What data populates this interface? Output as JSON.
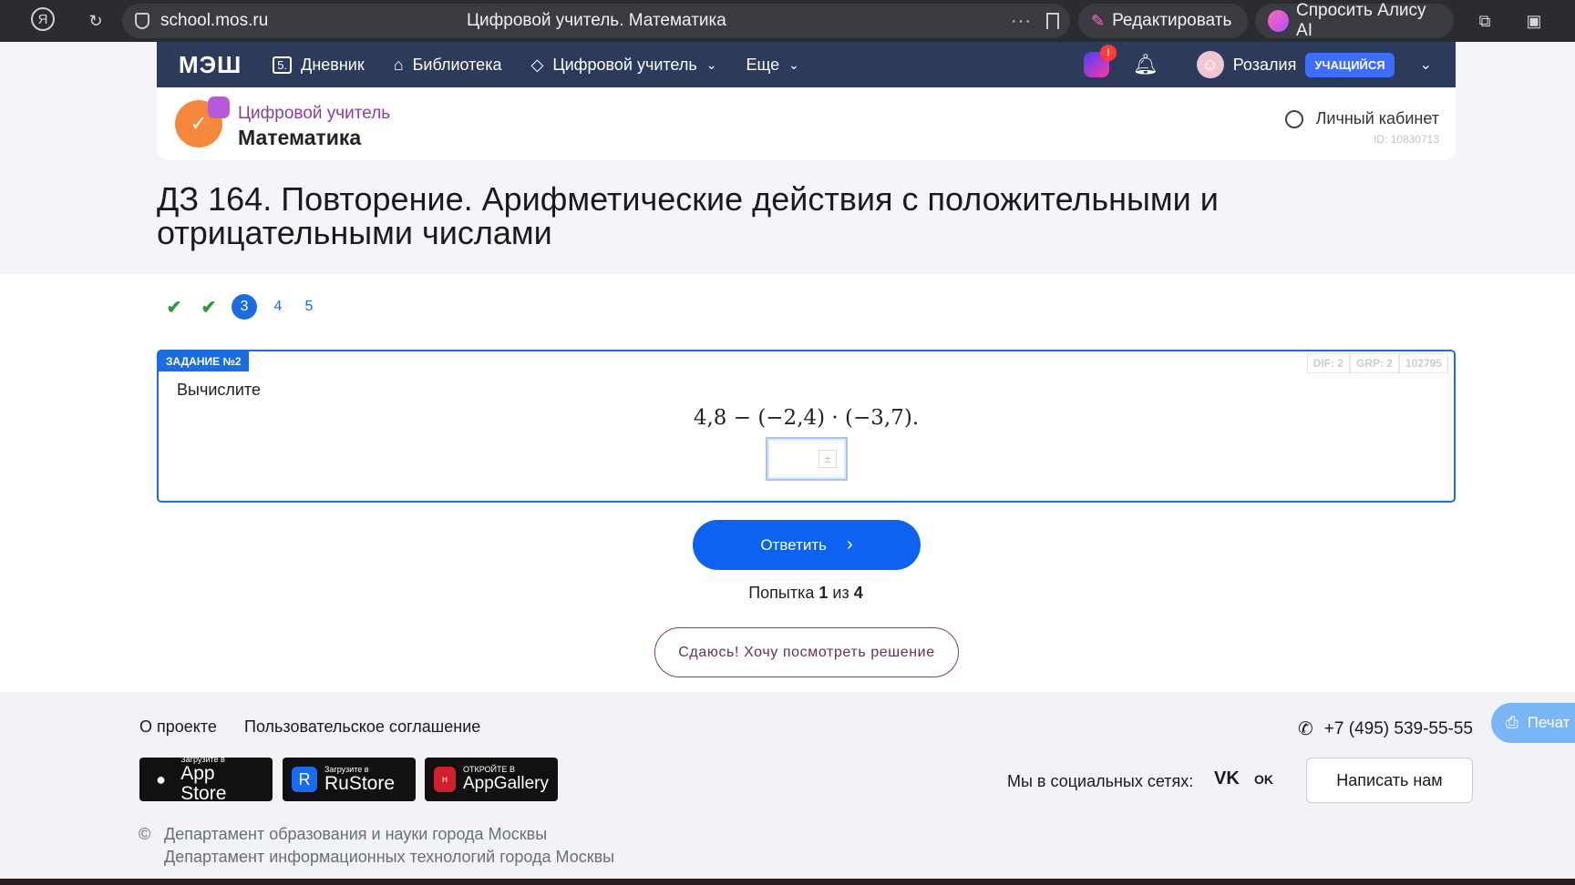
{
  "browser": {
    "url": "school.mos.ru",
    "page_title": "Цифровой учитель. Математика",
    "edit_label": "Редактировать",
    "alice_label": "Спросить Алису AI"
  },
  "nav": {
    "logo": "МЭШ",
    "items": [
      {
        "label": "Дневник",
        "icon": "diary-icon"
      },
      {
        "label": "Библиотека",
        "icon": "library-icon"
      },
      {
        "label": "Цифровой учитель",
        "icon": "cube-icon"
      },
      {
        "label": "Еще",
        "icon": ""
      }
    ],
    "ai_badge": "!",
    "user_name": "Розалия",
    "role": "УЧАЩИЙСЯ"
  },
  "product": {
    "subtitle": "Цифровой учитель",
    "title": "Математика",
    "cabinet": "Личный кабинет",
    "user_id": "ID: 10830713"
  },
  "page": {
    "title": "ДЗ 164. Повторение. Арифметические действия с положительными и отрицательными числами"
  },
  "steps": [
    {
      "state": "done",
      "label": "✔"
    },
    {
      "state": "done",
      "label": "✔"
    },
    {
      "state": "active",
      "label": "3"
    },
    {
      "state": "todo",
      "label": "4"
    },
    {
      "state": "todo",
      "label": "5"
    }
  ],
  "task": {
    "label": "ЗАДАНИЕ №2",
    "meta": [
      "DIF: 2",
      "GRP: 2",
      "102795"
    ],
    "instruction": "Вычислите",
    "formula": "4,8 − (−2,4) · (−3,7).",
    "answer_value": "",
    "submit_label": "Ответить",
    "attempt_prefix": "Попытка ",
    "attempt_current": "1",
    "attempt_middle": " из ",
    "attempt_total": "4",
    "giveup_label": "Сдаюсь! Хочу посмотреть решение"
  },
  "footer": {
    "links": [
      "О проекте",
      "Пользовательское соглашение"
    ],
    "stores": [
      {
        "small": "Загрузите в",
        "big": "App Store"
      },
      {
        "small": "Загрузите в",
        "big": "RuStore"
      },
      {
        "small": "ОТКРОЙТЕ В",
        "big": "AppGallery"
      }
    ],
    "phone": "+7 (495) 539-55-55",
    "social_label": "Мы в социальных сетях:",
    "social": [
      "VK",
      "OK"
    ],
    "write_label": "Написать нам",
    "print_label": "Печат",
    "copyright_lines": [
      "Департамент образования и науки города Москвы",
      "Департамент информационных технологий города Москвы"
    ]
  },
  "colors": {
    "nav_bg": "#2c3a5c",
    "accent": "#1a6de0",
    "submit": "#0d63f0",
    "success": "#2a9d3b"
  }
}
